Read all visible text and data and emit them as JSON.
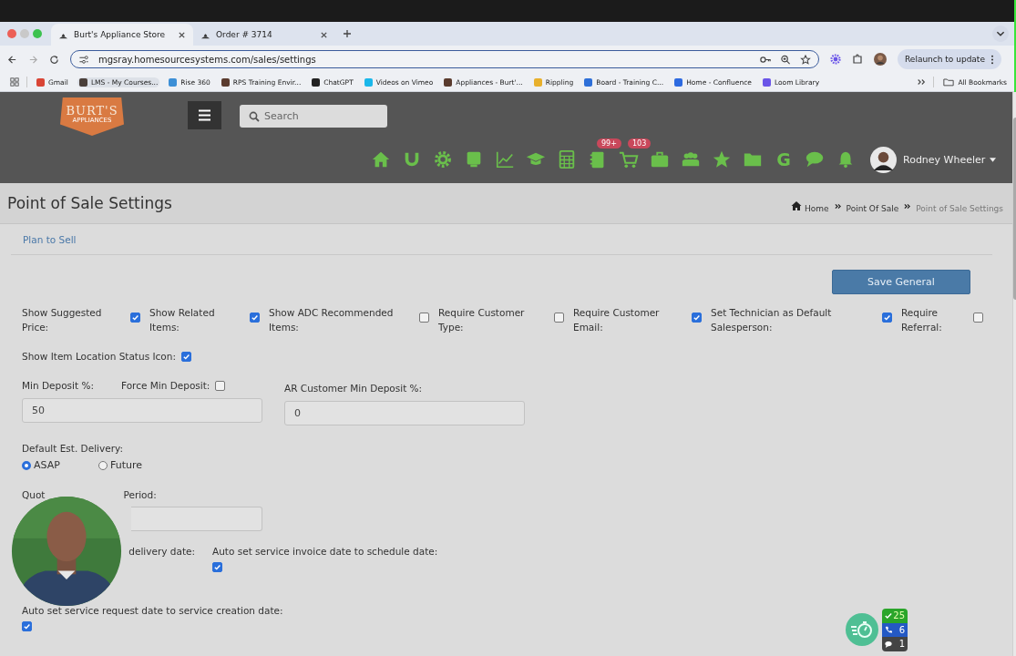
{
  "browser": {
    "tabs": [
      {
        "title": "Burt's Appliance Store",
        "selected": true
      },
      {
        "title": "Order # 3714",
        "selected": false
      }
    ],
    "url": "mgsray.homesourcesystems.com/sales/settings",
    "relaunch_button": "Relaunch to update",
    "bookmarks": [
      {
        "label": "Gmail",
        "color": "#d94535"
      },
      {
        "label": "LMS - My Courses...",
        "color": "#4a3f3a"
      },
      {
        "label": "Rise 360",
        "color": "#3d8fd6"
      },
      {
        "label": "RPS Training Envir...",
        "color": "#5a3b2e"
      },
      {
        "label": "ChatGPT",
        "color": "#222222"
      },
      {
        "label": "Videos on Vimeo",
        "color": "#1ab7ea"
      },
      {
        "label": "Appliances - Burt'...",
        "color": "#5a3b2e"
      },
      {
        "label": "Rippling",
        "color": "#e8b02c"
      },
      {
        "label": "Board - Training C...",
        "color": "#2e6fd8"
      },
      {
        "label": "Home - Confluence",
        "color": "#2d6ae0"
      },
      {
        "label": "Loom Library",
        "color": "#6a55e8"
      }
    ],
    "all_bookmarks": "All Bookmarks"
  },
  "header": {
    "logo": {
      "name": "BURT'S",
      "sub": "APPLIANCES"
    },
    "search": {
      "placeholder": "Search"
    },
    "nav": [
      {
        "kind": "home"
      },
      {
        "kind": "magnet"
      },
      {
        "kind": "gear"
      },
      {
        "kind": "monitor"
      },
      {
        "kind": "chart"
      },
      {
        "kind": "cap"
      },
      {
        "kind": "calculator"
      },
      {
        "kind": "notebook",
        "badge": "99+"
      },
      {
        "kind": "cart",
        "badge": "103"
      },
      {
        "kind": "briefcase"
      },
      {
        "kind": "people"
      },
      {
        "kind": "star"
      },
      {
        "kind": "folder"
      },
      {
        "kind": "letter",
        "label": "G"
      },
      {
        "kind": "chat"
      },
      {
        "kind": "bell"
      }
    ],
    "user": "Rodney Wheeler"
  },
  "page": {
    "title": "Point of Sale Settings",
    "breadcrumbs": [
      {
        "label": "Home",
        "current": false
      },
      {
        "label": "Point Of Sale",
        "current": false
      },
      {
        "label": "Point of Sale Settings",
        "current": true
      }
    ],
    "subtab": "Plan to Sell",
    "save_button": "Save General",
    "options": [
      {
        "label": "Show Suggested Price:",
        "checked": true
      },
      {
        "label": "Show Related Items:",
        "checked": true
      },
      {
        "label": "Show ADC Recommended Items:",
        "checked": false
      },
      {
        "label": "Require Customer Type:",
        "checked": false
      },
      {
        "label": "Require Customer Email:",
        "checked": true
      },
      {
        "label": "Set Technician as Default Salesperson:",
        "checked": true
      },
      {
        "label": "Require Referral:",
        "checked": false
      }
    ],
    "location_icon": {
      "label": "Show Item Location Status Icon:",
      "checked": true
    },
    "min_deposit": {
      "label": "Min Deposit %:",
      "value": "50"
    },
    "force_min_deposit": {
      "label": "Force Min Deposit:",
      "checked": false
    },
    "ar_min_deposit": {
      "label": "AR Customer Min Deposit %:",
      "value": "0"
    },
    "delivery": {
      "label": "Default Est. Delivery:",
      "options": [
        {
          "label": "ASAP",
          "selected": true
        },
        {
          "label": "Future",
          "selected": false
        }
      ]
    },
    "quote_period": {
      "label_start": "Quot",
      "label_end": "Period:"
    },
    "delivery_date": {
      "label": "delivery date:"
    },
    "invoice_date": {
      "label": "Auto set service invoice date to schedule date:",
      "checked": true
    },
    "request_date": {
      "label": "Auto set service request date to service creation date:",
      "checked": true
    }
  },
  "widgets": {
    "counters": [
      {
        "kind": "tasks",
        "count": "25",
        "color": "#2aa52a"
      },
      {
        "kind": "calls",
        "count": "6",
        "color": "#2459c4"
      },
      {
        "kind": "messages",
        "count": "1",
        "color": "#444444"
      }
    ]
  }
}
